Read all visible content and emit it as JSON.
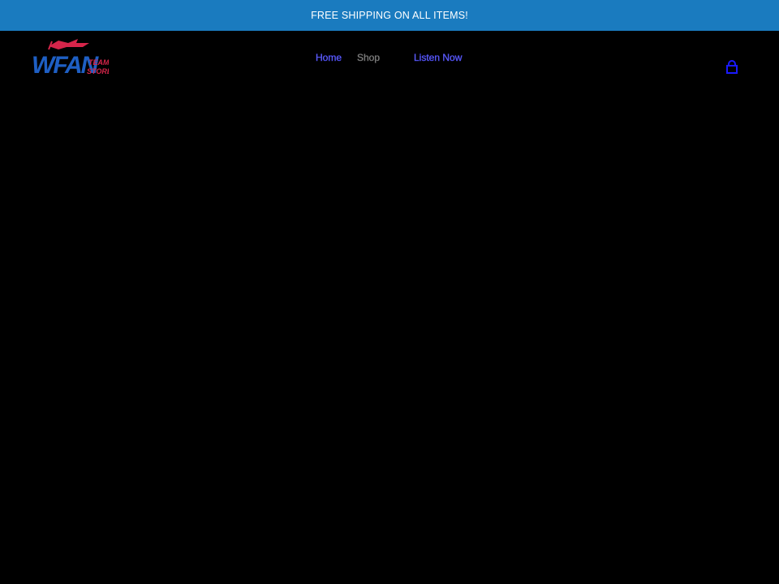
{
  "announcement": {
    "text": "FREE SHIPPING ON ALL ITEMS!"
  },
  "logo": {
    "primary_text": "WFAN",
    "secondary_line1": "TEAM",
    "secondary_line2": "STORE",
    "colors": {
      "primary": "#1e5fc4",
      "secondary": "#d6254a"
    }
  },
  "nav": {
    "items": [
      {
        "label": "Home"
      },
      {
        "label": "Shop"
      },
      {
        "label": "Listen Now"
      }
    ]
  },
  "header": {
    "cart_icon": "cart-bag-icon"
  },
  "colors": {
    "announcement_bg": "#1a7bbf",
    "page_bg": "#000000",
    "link": "#7b7bff",
    "cart_icon": "#1a1aff"
  }
}
